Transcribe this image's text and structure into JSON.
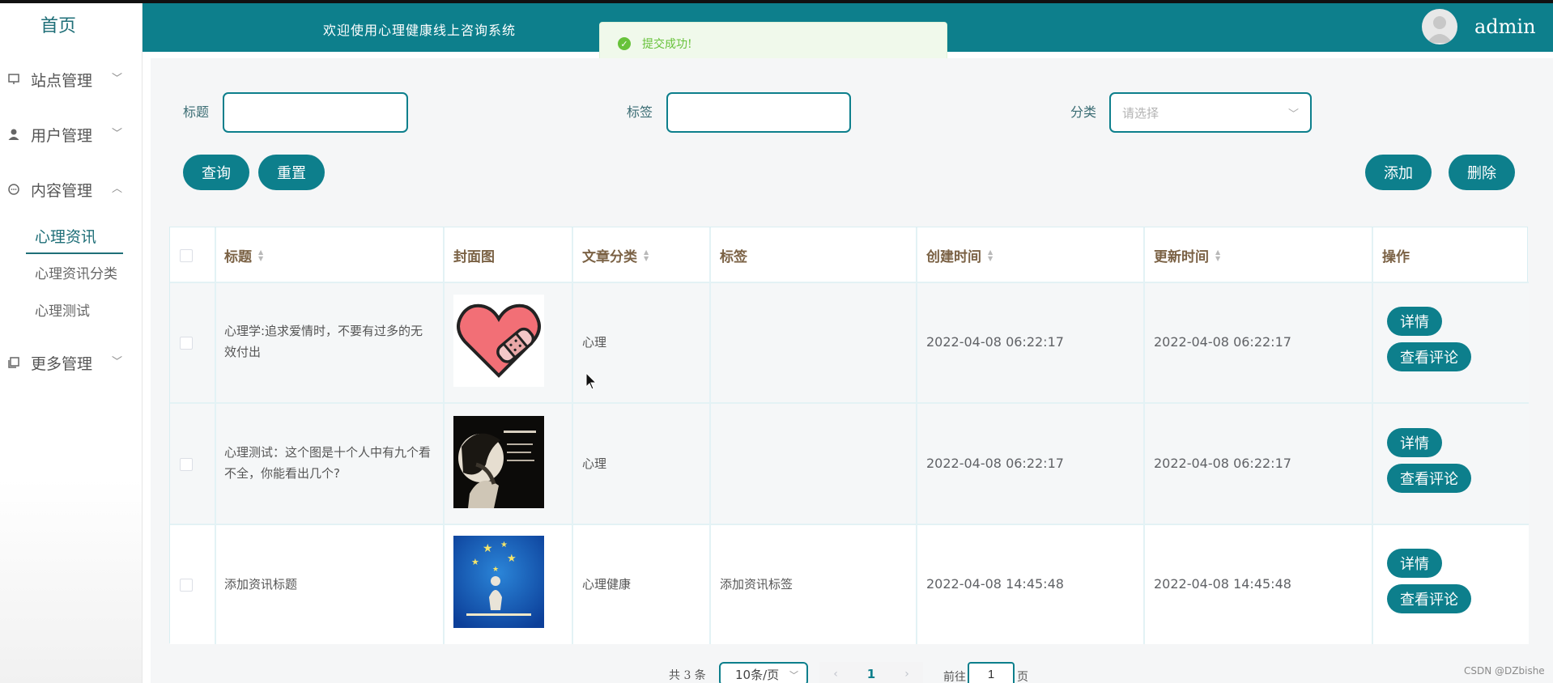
{
  "sidebar": {
    "home": "首页",
    "menus": [
      {
        "label": "站点管理",
        "icon": "monitor-icon",
        "expanded": false
      },
      {
        "label": "用户管理",
        "icon": "user-icon",
        "expanded": false
      },
      {
        "label": "内容管理",
        "icon": "chat-icon",
        "expanded": true
      },
      {
        "label": "更多管理",
        "icon": "copy-icon",
        "expanded": false
      }
    ],
    "submenu": [
      "心理资讯",
      "心理资讯分类",
      "心理测试"
    ]
  },
  "header": {
    "welcome": "欢迎使用心理健康线上咨询系统",
    "username": "admin"
  },
  "toast": {
    "message": "提交成功!"
  },
  "search": {
    "title_label": "标题",
    "tag_label": "标签",
    "category_label": "分类",
    "category_placeholder": "请选择",
    "title_value": "",
    "tag_value": ""
  },
  "buttons": {
    "query": "查询",
    "reset": "重置",
    "add": "添加",
    "delete": "删除"
  },
  "table": {
    "headers": [
      "标题",
      "封面图",
      "文章分类",
      "标签",
      "创建时间",
      "更新时间",
      "操作"
    ],
    "rows": [
      {
        "title": "心理学:追求爱情时，不要有过多的无效付出",
        "cover": "heart-bandage-image",
        "category": "心理",
        "tag": "",
        "created": "2022-04-08 06:22:17",
        "updated": "2022-04-08 06:22:17"
      },
      {
        "title": "心理测试：这个图是十个人中有九个看不全，你能看出几个?",
        "cover": "dark-illusion-image",
        "category": "心理",
        "tag": "",
        "created": "2022-04-08 06:22:17",
        "updated": "2022-04-08 06:22:17"
      },
      {
        "title": "添加资讯标题",
        "cover": "blue-stars-image",
        "category": "心理健康",
        "tag": "添加资讯标签",
        "created": "2022-04-08 14:45:48",
        "updated": "2022-04-08 14:45:48"
      }
    ],
    "detail_label": "详情",
    "comments_label": "查看评论"
  },
  "pagination": {
    "total": "共 3 条",
    "page_size": "10条/页",
    "current": "1",
    "goto_prefix": "前往",
    "goto_value": "1",
    "goto_suffix": "页"
  },
  "watermark": "CSDN @DZbishe",
  "colors": {
    "primary": "#0d7f8c",
    "success": "#67c23a",
    "header_text": "#7b6245"
  }
}
